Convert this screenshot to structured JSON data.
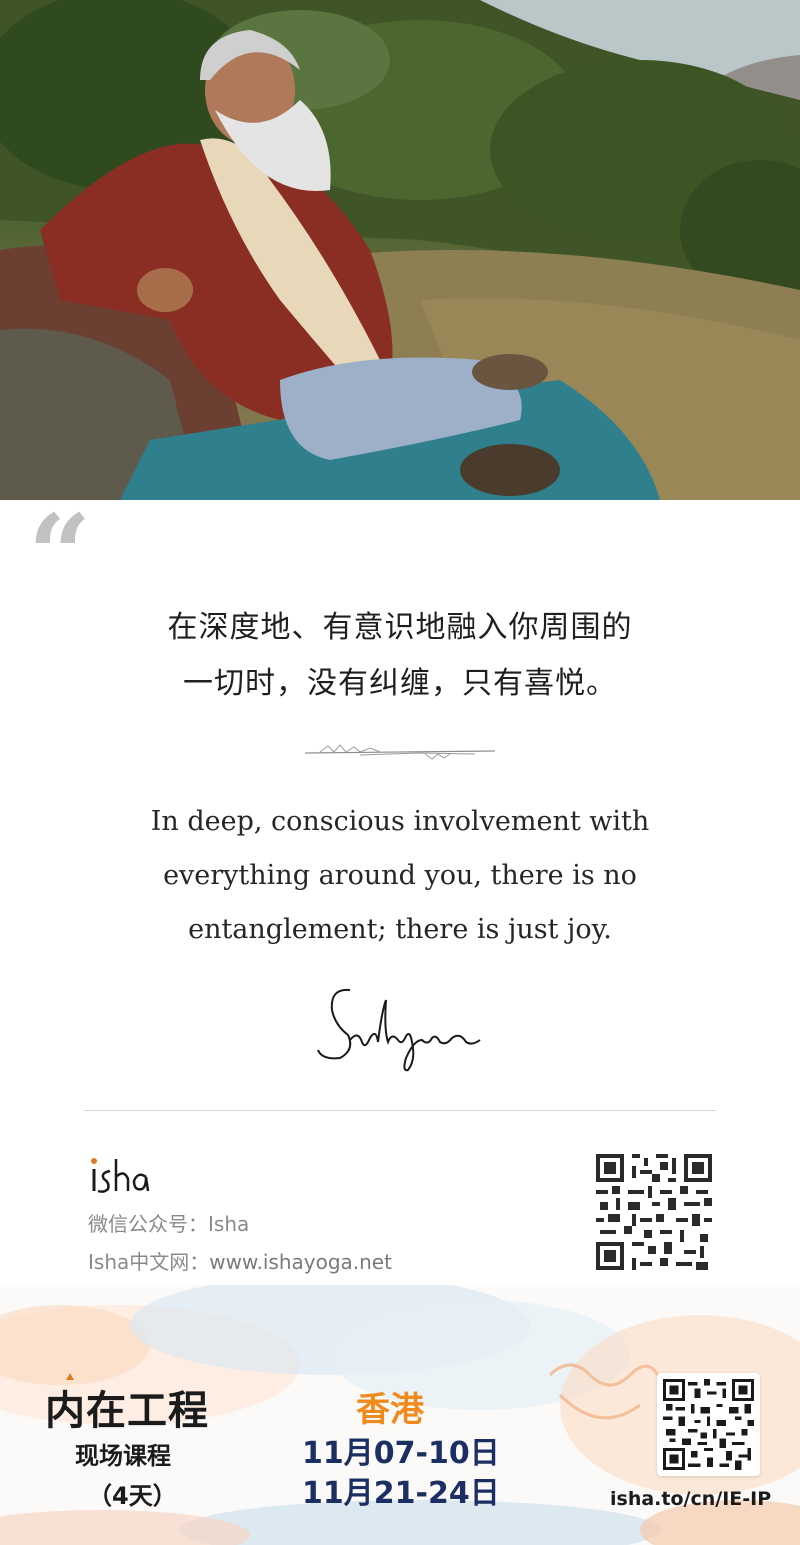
{
  "quote": {
    "mark": "“",
    "zh_lines": [
      "在深度地、有意识地融入你周围的",
      "一切时，没有纠缠，只有喜悦。"
    ],
    "en_lines": [
      "In deep, conscious involvement with",
      "everything around you, there is no",
      "entanglement; there is just joy."
    ],
    "signature": "Sadhguru"
  },
  "footer": {
    "logo_text": "isha",
    "wechat": "微信公众号：Isha",
    "website_label": "Isha中文网：",
    "website_url": "www.ishayoga.net"
  },
  "banner": {
    "course_title": "内在工程",
    "course_subtitle": "现场课程",
    "course_days": "（4天）",
    "city": "香港",
    "dates": [
      "11月07-10日",
      "11月21-24日"
    ],
    "link": "isha.to/cn/IE-IP"
  },
  "colors": {
    "city": "#f08a1c",
    "dates": "#1c2f63",
    "quote_mark": "#c2c2c2"
  }
}
